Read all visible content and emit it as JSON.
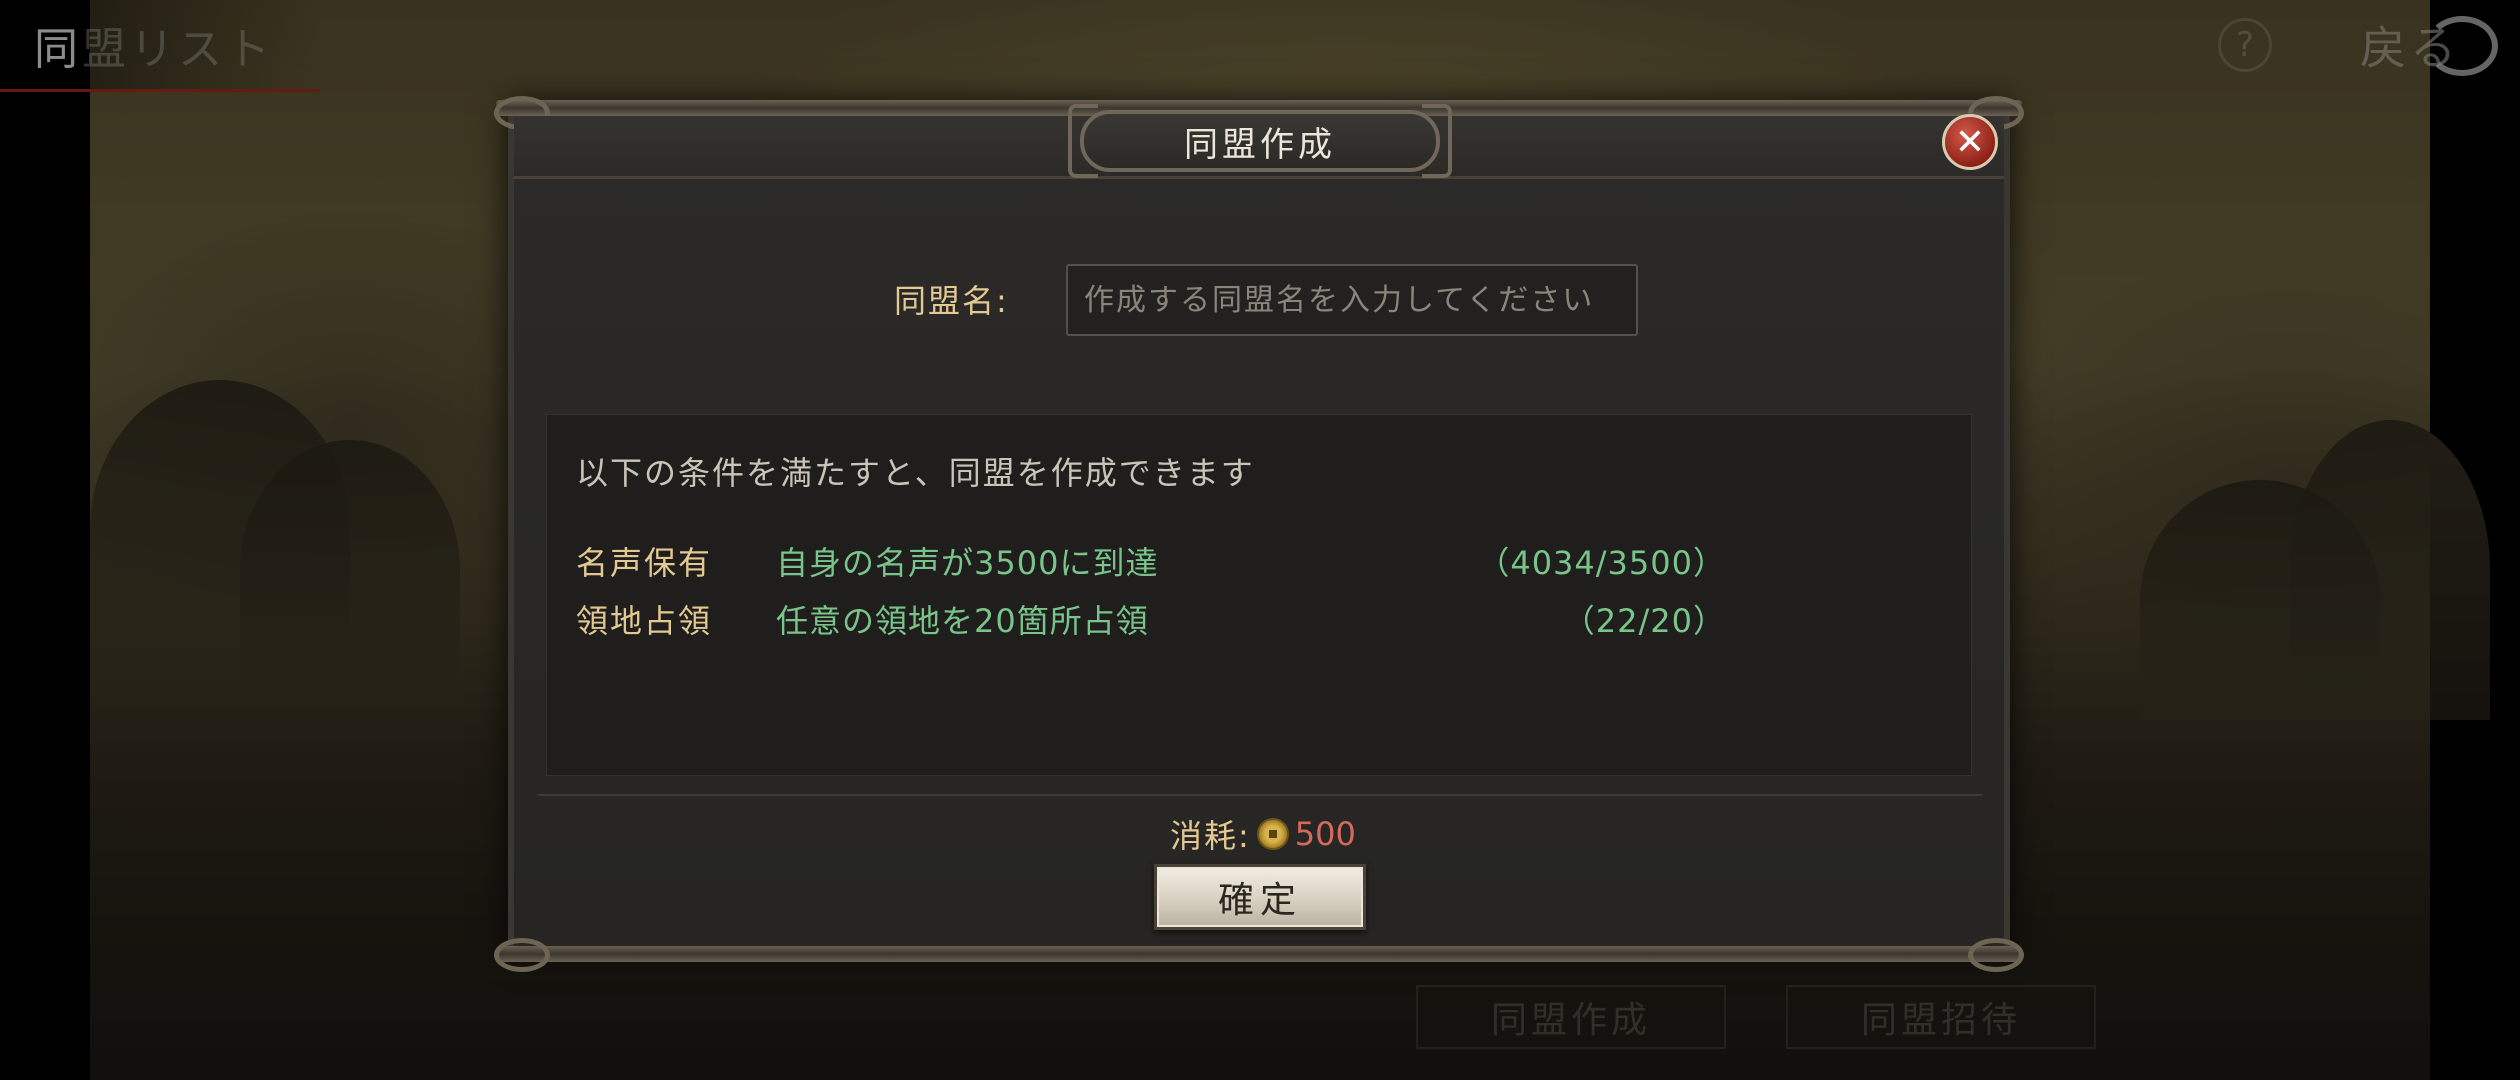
{
  "header": {
    "title_visible": "同",
    "title_faded": "盟リスト",
    "help_label": "?",
    "back_label": "戻る"
  },
  "bottom_buttons": {
    "create_label": "同盟作成",
    "invite_label": "同盟招待"
  },
  "dialog": {
    "title": "同盟作成",
    "close_label": "✕",
    "name_label": "同盟名:",
    "name_input": {
      "value": "",
      "placeholder": "作成する同盟名を入力してください"
    },
    "conditions_intro": "以下の条件を満たすと、同盟を作成できます",
    "conditions": [
      {
        "name": "名声保有",
        "description": "自身の名声が3500に到達",
        "progress": "（4034/3500）"
      },
      {
        "name": "領地占領",
        "description": "任意の領地を20箇所占領",
        "progress": "（22/20）"
      }
    ],
    "cost_label": "消耗:",
    "cost_icon": "coin-icon",
    "cost_value": "500",
    "confirm_label": "確定"
  },
  "colors": {
    "label_gold": "#e3c891",
    "condition_green": "#78c48a",
    "cost_red": "#d56a5a",
    "accent_red": "#b8321e"
  }
}
